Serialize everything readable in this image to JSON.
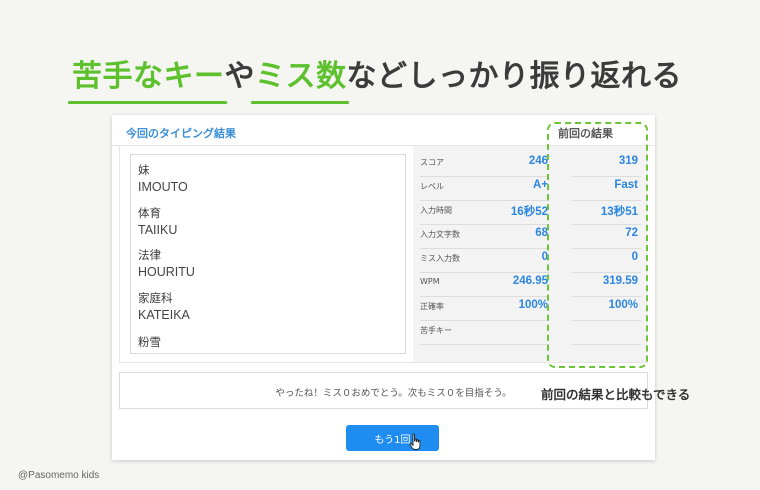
{
  "headline": {
    "part1": "苦手なキー",
    "part2": "や",
    "part3": "ミス数",
    "part4": "などしっかり振り返れる"
  },
  "card": {
    "title": "今回のタイピング結果",
    "previous_title": "前回の結果"
  },
  "words": [
    {
      "jp": "妹",
      "romaji": "IMOUTO"
    },
    {
      "jp": "体育",
      "romaji": "TAIIKU"
    },
    {
      "jp": "法律",
      "romaji": "HOURITU"
    },
    {
      "jp": "家庭科",
      "romaji": "KATEIKA"
    },
    {
      "jp": "粉雪",
      "romaji": ""
    }
  ],
  "stats": [
    {
      "label": "スコア",
      "current": "246",
      "previous": "319"
    },
    {
      "label": "レベル",
      "current": "A+",
      "previous": "Fast"
    },
    {
      "label": "入力時間",
      "current": "16秒52",
      "previous": "13秒51"
    },
    {
      "label": "入力文字数",
      "current": "68",
      "previous": "72"
    },
    {
      "label": "ミス入力数",
      "current": "0",
      "previous": "0"
    },
    {
      "label": "WPM",
      "current": "246.95",
      "previous": "319.59"
    },
    {
      "label": "正確率",
      "current": "100%",
      "previous": "100%"
    },
    {
      "label": "苦手キー",
      "current": "",
      "previous": ""
    }
  ],
  "message": "やったね！ミス０おめでとう。次もミス０を目指そう。",
  "retry_button": "もう1回",
  "compare_note": "前回の結果と比較もできる",
  "credit": "@Pasomemo kids",
  "colors": {
    "accent_green": "#5cc12d",
    "accent_blue": "#2a86e0",
    "button_blue": "#1e8cf0"
  }
}
